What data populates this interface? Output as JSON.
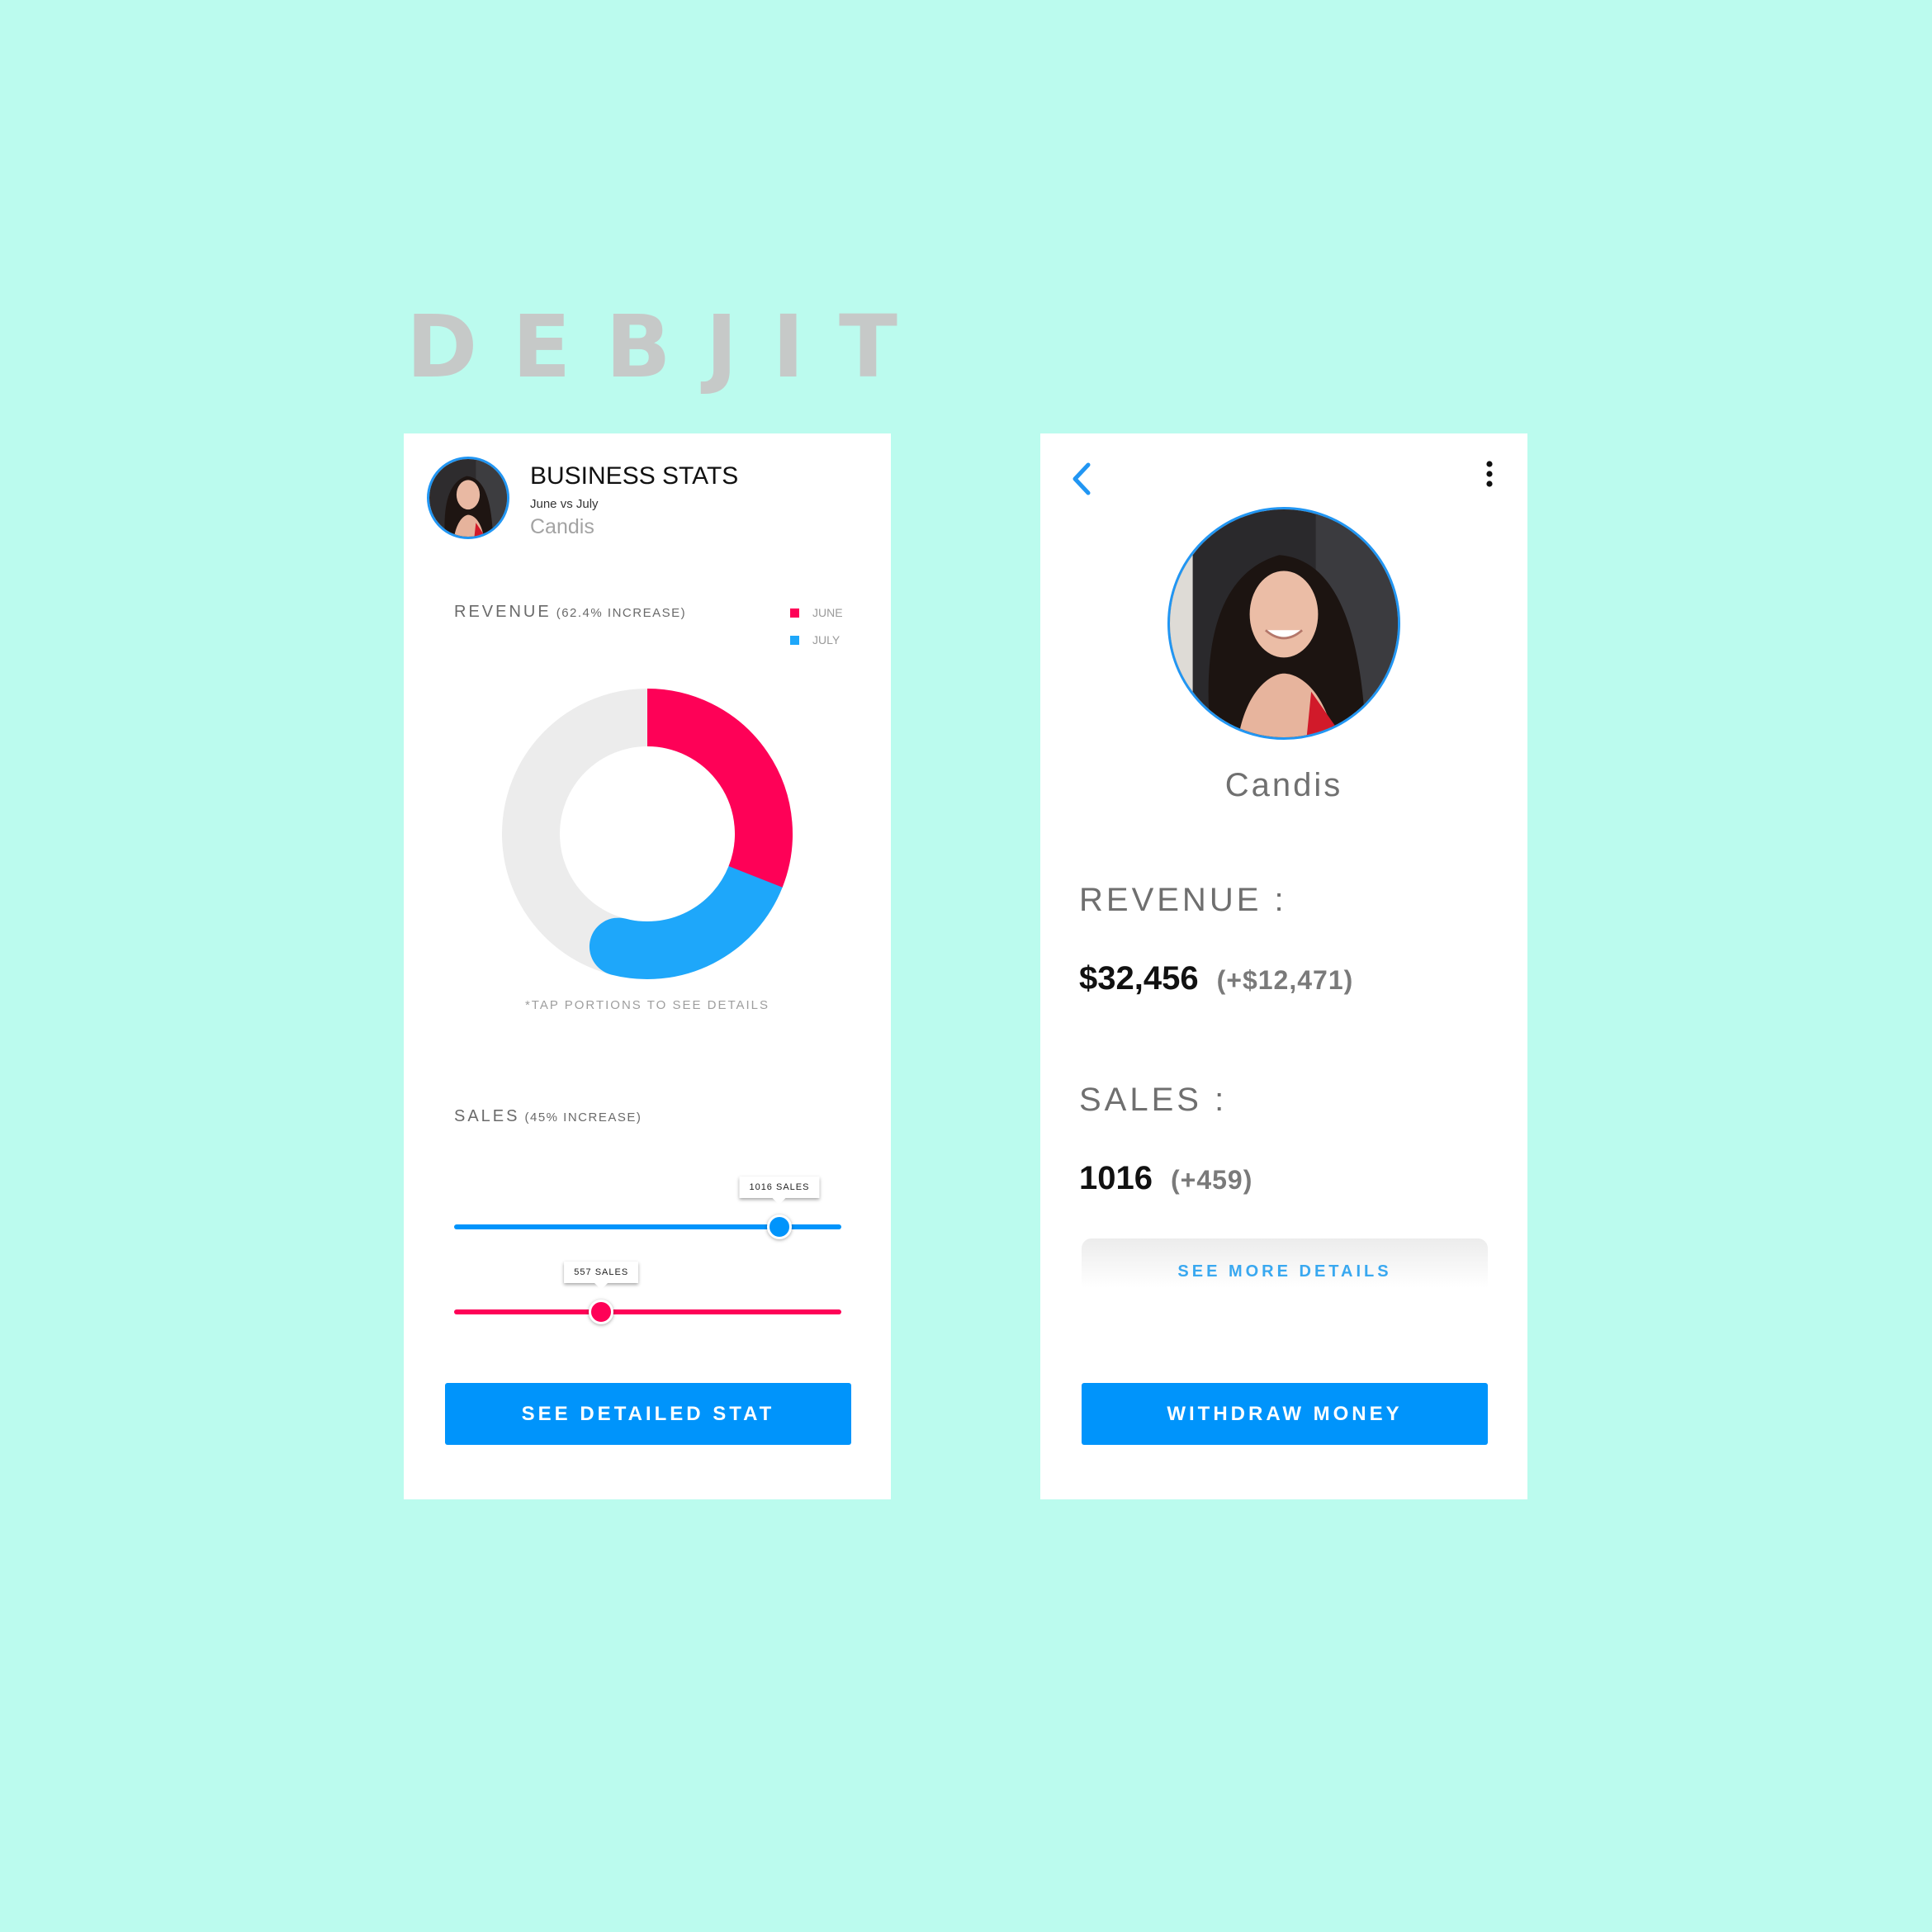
{
  "brand": "DEBJIT",
  "colors": {
    "background": "#bbfbee",
    "primary_blue": "#0094fb",
    "june": "#fe0157",
    "july": "#1ea7fa",
    "remainder": "#ececec"
  },
  "stats_screen": {
    "header": {
      "title": "BUSINESS STATS",
      "subtitle": "June vs July",
      "user": "Candis"
    },
    "revenue": {
      "label": "REVENUE",
      "note": "(62.4% INCREASE)"
    },
    "legend": [
      {
        "label": "JUNE",
        "color": "#fe0157"
      },
      {
        "label": "JULY",
        "color": "#1ea7fa"
      }
    ],
    "hint": "*TAP PORTIONS TO SEE DETAILS",
    "sales": {
      "label": "SALES",
      "note": "(45% INCREASE)",
      "sliders": [
        {
          "tooltip": "1016 SALES",
          "level": 0.84,
          "color": "#0094fb"
        },
        {
          "tooltip": "557 SALES",
          "level": 0.38,
          "color": "#fe0157"
        }
      ]
    },
    "button": "SEE DETAILED STAT"
  },
  "chart_data": {
    "type": "pie",
    "style": "donut",
    "series": [
      {
        "name": "JUNE",
        "value": 0.31,
        "color": "#fe0157"
      },
      {
        "name": "JULY",
        "value": 0.23,
        "color": "#1ea7fa"
      }
    ],
    "remainder": 0.46,
    "legend_position": "top-right"
  },
  "profile_screen": {
    "icons": {
      "back": "chevron-left-icon",
      "menu": "more-vertical-icon"
    },
    "user": "Candis",
    "revenue": {
      "label": "REVENUE :",
      "value": "$32,456",
      "delta": "(+$12,471)"
    },
    "sales": {
      "label": "SALES :",
      "value": "1016",
      "delta": "(+459)"
    },
    "details_button": "SEE MORE DETAILS",
    "button": "WITHDRAW MONEY"
  }
}
